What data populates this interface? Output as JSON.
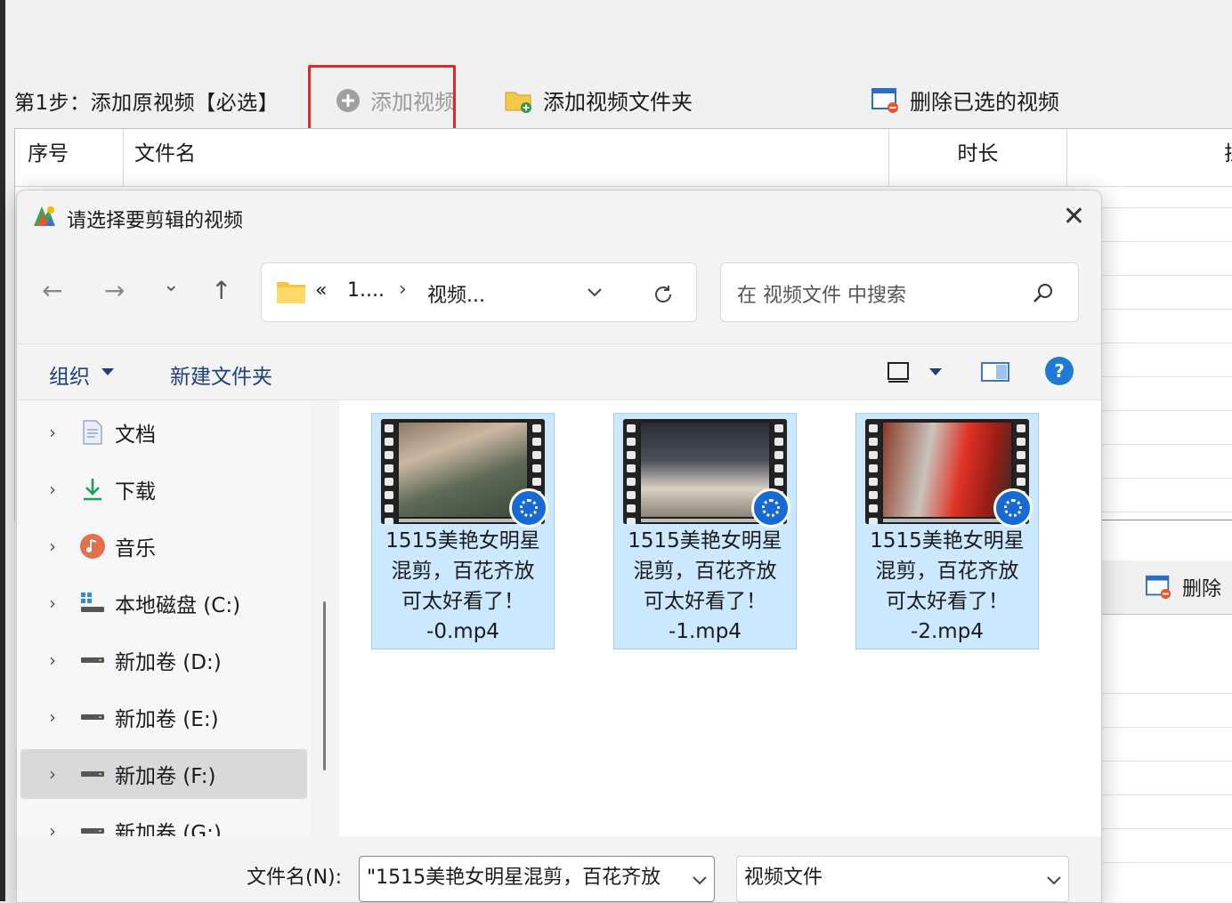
{
  "app": {
    "step_label": "第1步：添加原视频【必选】",
    "toolbar": {
      "add_video": "添加视频",
      "add_folder": "添加视频文件夹",
      "delete_selected": "删除已选的视频"
    },
    "grid_headers": [
      "序号",
      "文件名",
      "时长",
      "拉"
    ],
    "lower_toolbar_delete": "删除"
  },
  "dialog": {
    "title": "请选择要剪辑的视频",
    "close": "✕",
    "nav": {
      "back": "←",
      "forward": "→",
      "recent": "⌄",
      "up": "↑"
    },
    "breadcrumb": {
      "overflow": "«",
      "crumb1": "1....",
      "sep": "›",
      "crumb2": "视频..."
    },
    "search_placeholder": "在 视频文件 中搜索",
    "command_bar": {
      "organize": "组织",
      "new_folder": "新建文件夹"
    },
    "nav_items": [
      {
        "label": "文档",
        "icon": "document-icon"
      },
      {
        "label": "下载",
        "icon": "download-icon"
      },
      {
        "label": "音乐",
        "icon": "music-icon"
      },
      {
        "label": "本地磁盘 (C:)",
        "icon": "system-drive-icon"
      },
      {
        "label": "新加卷 (D:)",
        "icon": "drive-icon"
      },
      {
        "label": "新加卷 (E:)",
        "icon": "drive-icon"
      },
      {
        "label": "新加卷 (F:)",
        "icon": "drive-icon",
        "selected": true
      },
      {
        "label": "新加卷 (G:)",
        "icon": "drive-icon"
      }
    ],
    "files": [
      {
        "name": "1515美艳女明星\n混剪，百花齐放\n可太好看了！\n-0.mp4"
      },
      {
        "name": "1515美艳女明星\n混剪，百花齐放\n可太好看了！\n-1.mp4"
      },
      {
        "name": "1515美艳女明星\n混剪，百花齐放\n可太好看了！\n-2.mp4"
      }
    ],
    "filename_label": "文件名(N):",
    "filename_value": "\"1515美艳女明星混剪，百花齐放",
    "filetype_value": "视频文件"
  },
  "colors": {
    "highlight_red": "#e0282c",
    "selection_blue": "#cce8ff",
    "help_blue": "#1e7ad6"
  }
}
